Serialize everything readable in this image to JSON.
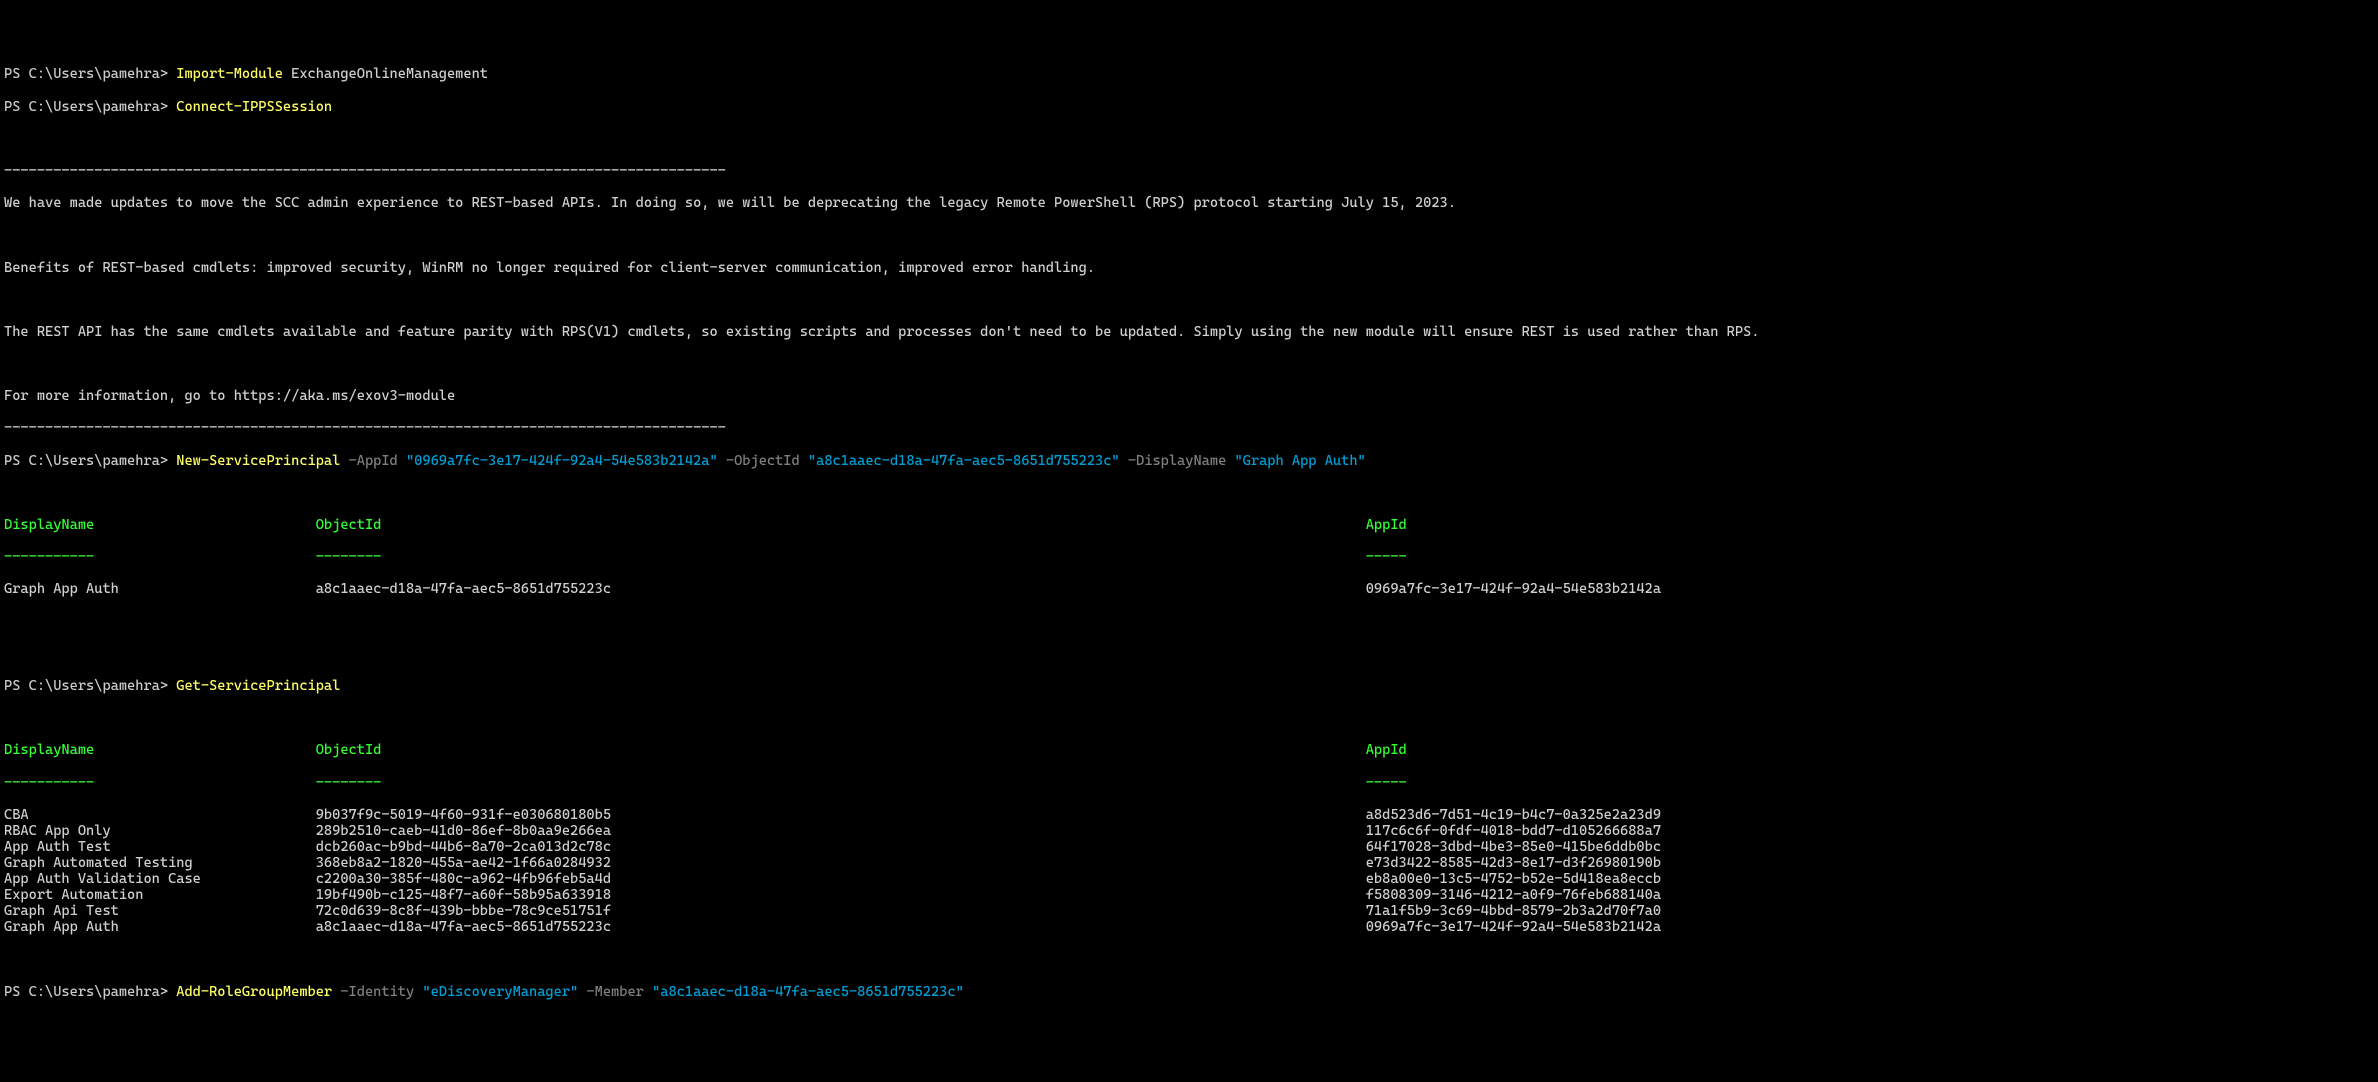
{
  "prompt": "PS C:\\Users\\pamehra> ",
  "cmd1": {
    "cmdlet": "Import-Module",
    "arg": "ExchangeOnlineManagement"
  },
  "cmd2": {
    "cmdlet": "Connect-IPPSSession"
  },
  "sep1": "----------------------------------------------------------------------------------------",
  "banner": {
    "l1": "We have made updates to move the SCC admin experience to REST-based APIs. In doing so, we will be deprecating the legacy Remote PowerShell (RPS) protocol starting July 15, 2023.",
    "l2": "Benefits of REST-based cmdlets: improved security, WinRM no longer required for client-server communication, improved error handling.",
    "l3": "The REST API has the same cmdlets available and feature parity with RPS(V1) cmdlets, so existing scripts and processes don't need to be updated. Simply using the new module will ensure REST is used rather than RPS.",
    "l4": "For more information, go to https://aka.ms/exov3-module"
  },
  "sep2": "----------------------------------------------------------------------------------------",
  "cmd3": {
    "cmdlet": "New-ServicePrincipal",
    "p1": " -AppId ",
    "v1": "\"0969a7fc-3e17-424f-92a4-54e583b2142a\"",
    "p2": " -ObjectId ",
    "v2": "\"a8c1aaec-d18a-47fa-aec5-8651d755223c\"",
    "p3": " -DisplayName ",
    "v3": "\"Graph App Auth\""
  },
  "headers": {
    "h1": "DisplayName",
    "h2": "ObjectId",
    "h3": "AppId",
    "u1": "-----------",
    "u2": "--------",
    "u3": "-----"
  },
  "cols": {
    "c1": 38,
    "c2": 128
  },
  "nsp_row": {
    "dn": "Graph App Auth",
    "oid": "a8c1aaec-d18a-47fa-aec5-8651d755223c",
    "aid": "0969a7fc-3e17-424f-92a4-54e583b2142a"
  },
  "cmd4": {
    "cmdlet": "Get-ServicePrincipal"
  },
  "rows": [
    {
      "dn": "CBA",
      "oid": "9b037f9c-5019-4f60-931f-e030680180b5",
      "aid": "a8d523d6-7d51-4c19-b4c7-0a325e2a23d9"
    },
    {
      "dn": "RBAC App Only",
      "oid": "289b2510-caeb-41d0-86ef-8b0aa9e266ea",
      "aid": "117c6c6f-0fdf-4018-bdd7-d105266688a7"
    },
    {
      "dn": "App Auth Test",
      "oid": "dcb260ac-b9bd-44b6-8a70-2ca013d2c78c",
      "aid": "64f17028-3dbd-4be3-85e0-415be6ddb0bc"
    },
    {
      "dn": "Graph Automated Testing",
      "oid": "368eb8a2-1820-455a-ae42-1f66a0284932",
      "aid": "e73d3422-8585-42d3-8e17-d3f26980190b"
    },
    {
      "dn": "App Auth Validation Case",
      "oid": "c2200a30-385f-480c-a962-4fb96feb5a4d",
      "aid": "eb8a00e0-13c5-4752-b52e-5d418ea8eccb"
    },
    {
      "dn": "Export Automation",
      "oid": "19bf490b-c125-48f7-a60f-58b95a633918",
      "aid": "f5808309-3146-4212-a0f9-76feb688140a"
    },
    {
      "dn": "Graph Api Test",
      "oid": "72c0d639-8c8f-439b-bbbe-78c9ce51751f",
      "aid": "71a1f5b9-3c69-4bbd-8579-2b3a2d70f7a0"
    },
    {
      "dn": "Graph App Auth",
      "oid": "a8c1aaec-d18a-47fa-aec5-8651d755223c",
      "aid": "0969a7fc-3e17-424f-92a4-54e583b2142a"
    }
  ],
  "cmd5": {
    "cmdlet": "Add-RoleGroupMember",
    "p1": " -Identity ",
    "v1": "\"eDiscoveryManager\"",
    "p2": " -Member ",
    "v2": "\"a8c1aaec-d18a-47fa-aec5-8651d755223c\""
  }
}
